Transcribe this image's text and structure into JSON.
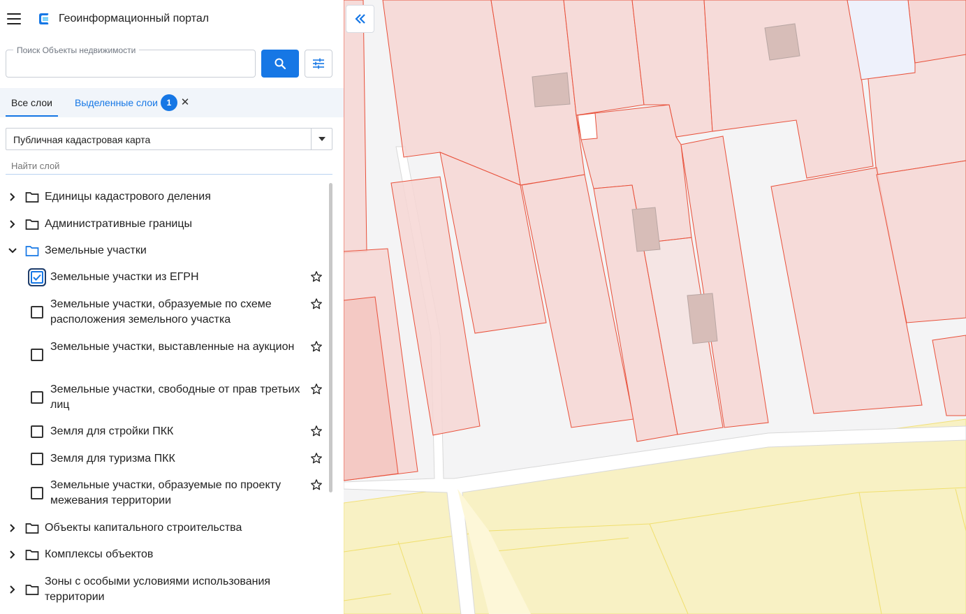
{
  "header": {
    "title": "Геоинформационный портал",
    "menu_icon": "menu-icon",
    "logo_icon": "portal-logo-icon"
  },
  "search": {
    "label": "Поиск Объекты недвижимости",
    "value": "",
    "search_icon": "search-icon",
    "filter_icon": "filter-settings-icon"
  },
  "tabs": {
    "all": "Все слои",
    "selected": "Выделенные слои",
    "selected_count": "1",
    "close": "✕"
  },
  "basemap": {
    "selected": "Публичная кадастровая карта"
  },
  "layer_search": {
    "placeholder": "Найти слой"
  },
  "tree": {
    "groups_top": [
      {
        "label": "Единицы кадастрового деления",
        "expanded": false
      },
      {
        "label": "Административные границы",
        "expanded": false
      },
      {
        "label": "Земельные участки",
        "expanded": true
      }
    ],
    "layers": [
      {
        "label": "Земельные участки из ЕГРН",
        "checked": true
      },
      {
        "label": "Земельные участки, образуемые по схеме расположения земельного участка",
        "checked": false
      },
      {
        "label": "Земельные участки, выставленные на аукцион",
        "checked": false
      },
      {
        "label": "Земельные участки, свободные от прав третьих лиц",
        "checked": false
      },
      {
        "label": "Земля для стройки ПКК",
        "checked": false
      },
      {
        "label": "Земля для туризма ПКК",
        "checked": false
      },
      {
        "label": "Земельные участки, образуемые по проекту межевания территории",
        "checked": false
      }
    ],
    "groups_bottom": [
      {
        "label": "Объекты капитального строительства",
        "expanded": false
      },
      {
        "label": "Комплексы объектов",
        "expanded": false
      },
      {
        "label": "Зоны с особыми условиями использования территории",
        "expanded": false
      }
    ]
  },
  "map": {
    "collapse_icon": "double-chevron-left-icon"
  },
  "colors": {
    "accent": "#1677e5",
    "parcel_fill": "#f6d6d3",
    "parcel_stroke": "#e8503a",
    "zone_fill": "#f8f1c4",
    "zone_stroke": "#f2e07a",
    "building_fill": "#d7bdb8"
  }
}
